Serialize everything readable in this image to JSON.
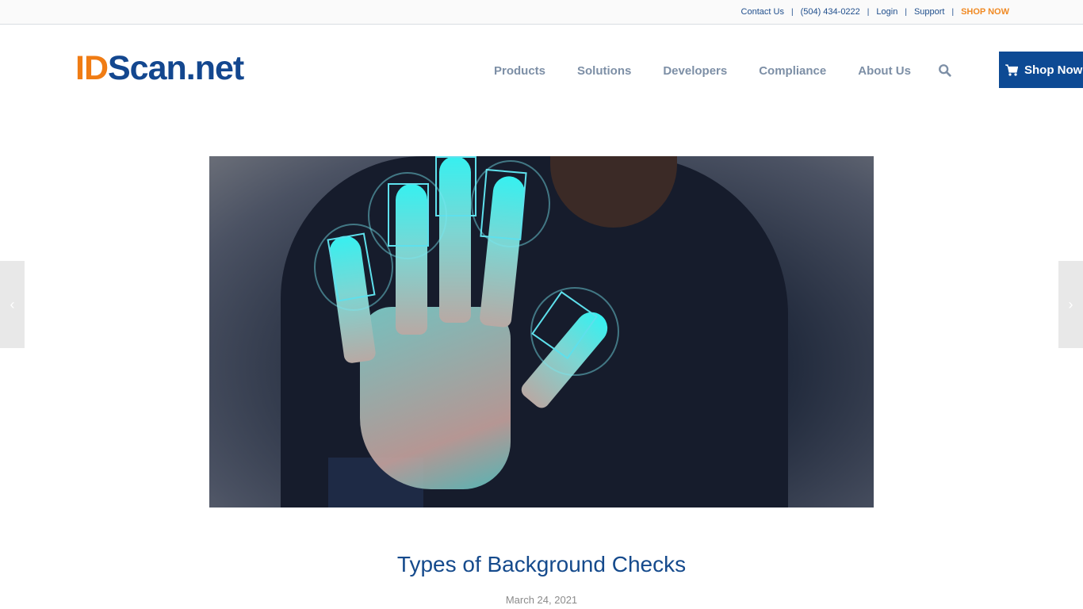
{
  "topbar": {
    "links": [
      {
        "label": "Contact Us"
      },
      {
        "label": "(504) 434-0222"
      },
      {
        "label": "Login"
      },
      {
        "label": "Support"
      },
      {
        "label": "SHOP NOW"
      }
    ],
    "separator": "|"
  },
  "header": {
    "logo": {
      "part1": "ID",
      "part2": "Scan.net"
    },
    "nav": [
      {
        "label": "Products"
      },
      {
        "label": "Solutions"
      },
      {
        "label": "Developers"
      },
      {
        "label": "Compliance"
      },
      {
        "label": "About Us"
      }
    ],
    "search_icon": "search-icon",
    "shop_button": {
      "label": "Shop Now",
      "icon": "cart-icon"
    }
  },
  "hero": {
    "alt": "Hand with fingerprint scanning overlay"
  },
  "carousel": {
    "prev": "‹",
    "next": "›"
  },
  "post": {
    "title": "Types of Background Checks",
    "date": "March 24, 2021"
  },
  "colors": {
    "brand_blue": "#13478f",
    "brand_orange": "#f07c14",
    "nav_gray": "#7d8fa6",
    "button_blue": "#0d4a94"
  }
}
